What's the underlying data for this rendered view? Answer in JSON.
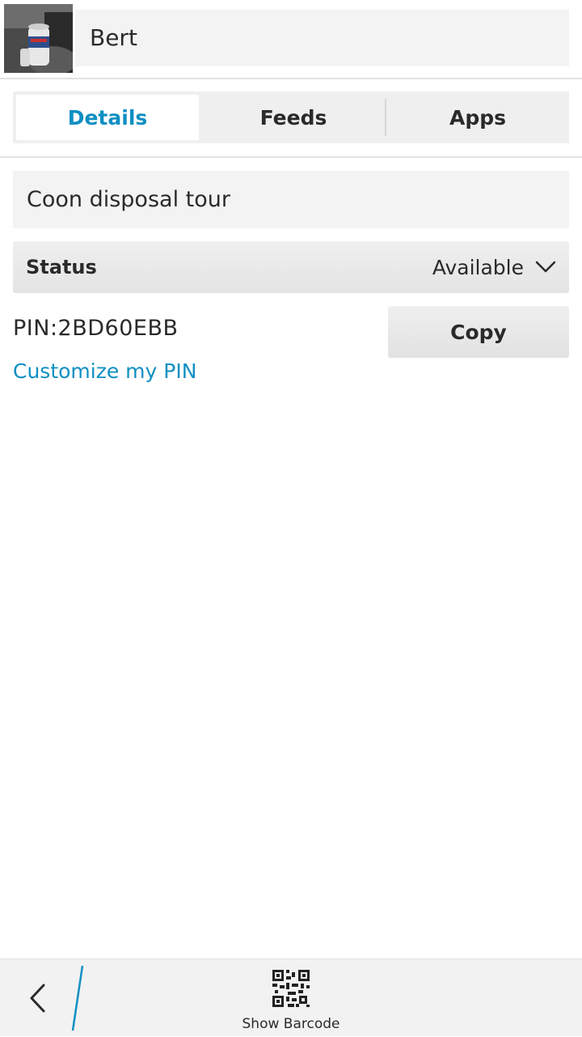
{
  "header": {
    "contact_name": "Bert",
    "avatar_icon": "avatar-photo"
  },
  "tabs": [
    {
      "label": "Details",
      "active": true
    },
    {
      "label": "Feeds",
      "active": false
    },
    {
      "label": "Apps",
      "active": false
    }
  ],
  "details": {
    "personal_message": "Coon disposal tour",
    "status": {
      "label": "Status",
      "value": "Available",
      "icon": "chevron-down-icon"
    },
    "pin": {
      "text": "PIN:2BD60EBB",
      "copy_label": "Copy",
      "customize_label": "Customize my PIN"
    }
  },
  "action_bar": {
    "back_icon": "back-chevron-icon",
    "barcode_icon": "qr-code-icon",
    "barcode_label": "Show Barcode"
  },
  "colors": {
    "accent": "#0f8fc2",
    "field_bg": "#f3f3f3",
    "text": "#2a2a2a"
  }
}
